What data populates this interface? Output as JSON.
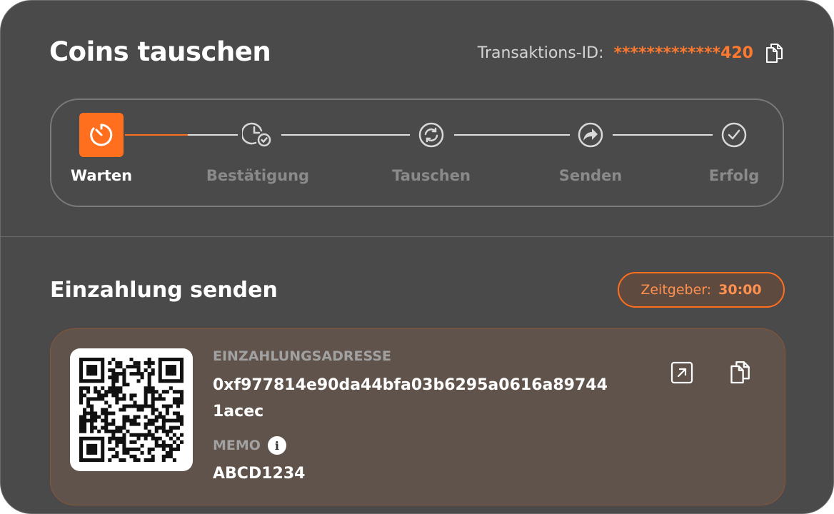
{
  "header": {
    "title": "Coins tauschen",
    "transaction_label": "Transaktions-ID:",
    "transaction_value": "*************420"
  },
  "steps": [
    {
      "label": "Warten",
      "icon": "timer-icon",
      "active": true
    },
    {
      "label": "Bestätigung",
      "icon": "clock-check-icon",
      "active": false
    },
    {
      "label": "Tauschen",
      "icon": "refresh-icon",
      "active": false
    },
    {
      "label": "Senden",
      "icon": "send-arrow-icon",
      "active": false
    },
    {
      "label": "Erfolg",
      "icon": "check-circle-icon",
      "active": false
    }
  ],
  "deposit": {
    "section_title": "Einzahlung senden",
    "timer_label": "Zeitgeber:",
    "timer_value": "30:00",
    "address_label": "EINZAHLUNGSADRESSE",
    "address_value": "0xf977814e90da44bfa03b6295a0616a897441acec",
    "memo_label": "MEMO",
    "memo_value": "ABCD1234"
  },
  "colors": {
    "accent": "#ff6f1e",
    "background": "#4a4a4a",
    "deposit_panel": "#5f534b"
  }
}
